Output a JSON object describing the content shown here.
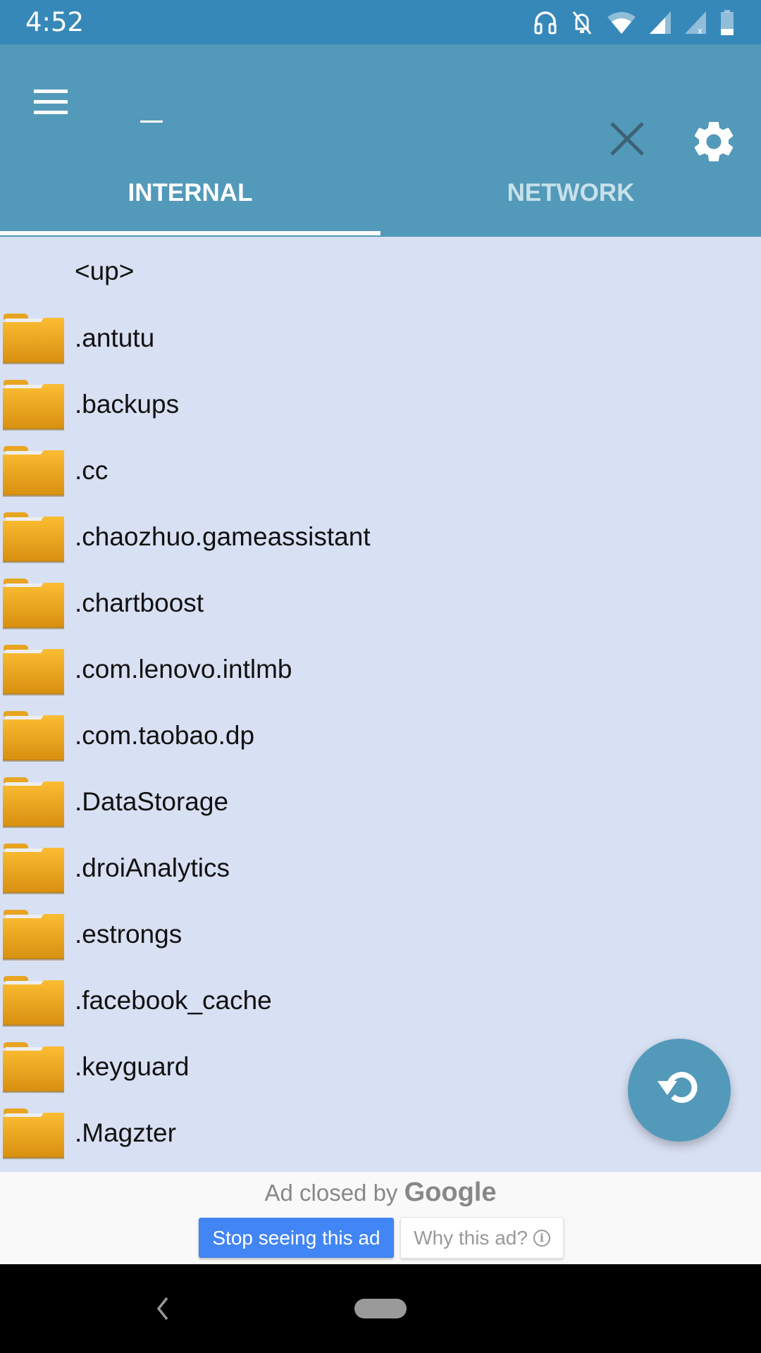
{
  "status_bar": {
    "time": "4:52",
    "icons": [
      "headphones-icon",
      "notifications-off-icon",
      "wifi-icon",
      "signal-icon",
      "signal-no-data-icon",
      "battery-icon"
    ]
  },
  "app_bar": {
    "search_value": "",
    "menu_icon": "hamburger-menu-icon",
    "close_icon": "close-icon",
    "settings_icon": "gear-icon"
  },
  "tabs": [
    {
      "label": "INTERNAL",
      "active": true
    },
    {
      "label": "NETWORK",
      "active": false
    }
  ],
  "file_list": {
    "up_label": "<up>",
    "items": [
      {
        "name": ".antutu",
        "type": "folder"
      },
      {
        "name": ".backups",
        "type": "folder"
      },
      {
        "name": ".cc",
        "type": "folder"
      },
      {
        "name": ".chaozhuo.gameassistant",
        "type": "folder"
      },
      {
        "name": ".chartboost",
        "type": "folder"
      },
      {
        "name": ".com.lenovo.intlmb",
        "type": "folder"
      },
      {
        "name": ".com.taobao.dp",
        "type": "folder"
      },
      {
        "name": ".DataStorage",
        "type": "folder"
      },
      {
        "name": ".droiAnalytics",
        "type": "folder"
      },
      {
        "name": ".estrongs",
        "type": "folder"
      },
      {
        "name": ".facebook_cache",
        "type": "folder"
      },
      {
        "name": ".keyguard",
        "type": "folder"
      },
      {
        "name": ".Magzter",
        "type": "folder"
      }
    ]
  },
  "fab": {
    "icon": "refresh-icon"
  },
  "ad": {
    "closed_text": "Ad closed by",
    "brand": "Google",
    "stop_label": "Stop seeing this ad",
    "why_label": "Why this ad?"
  },
  "colors": {
    "status_bar": "#3688b9",
    "app_bar": "#5399b9",
    "list_bg": "#d8e0f3",
    "ad_button": "#4285f4",
    "folder": "#f4b42a"
  }
}
